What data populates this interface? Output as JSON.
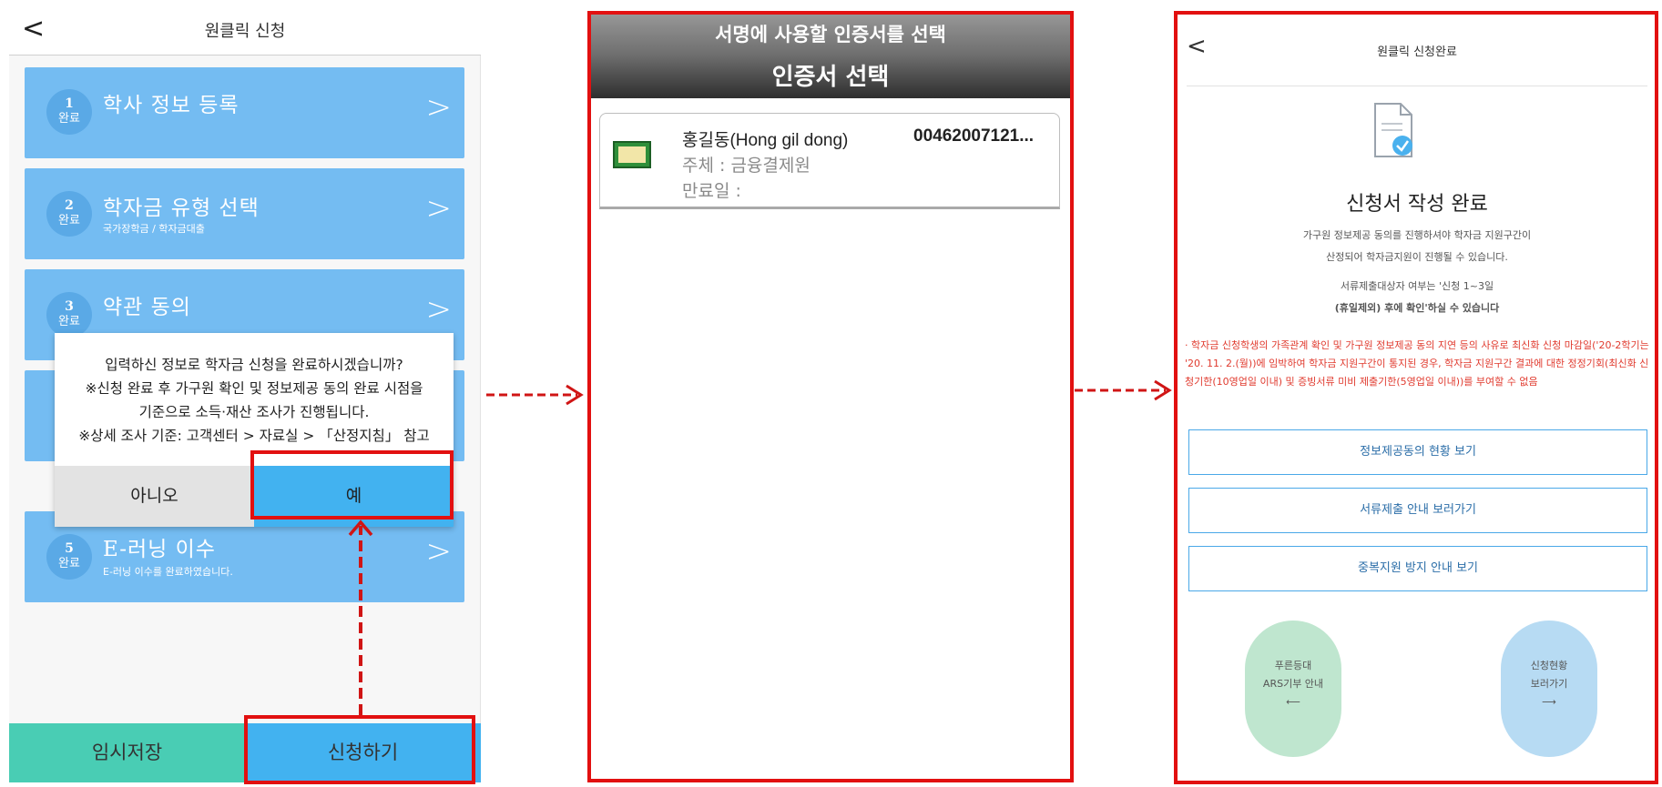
{
  "panel1": {
    "back_icon": "chevron-left-icon",
    "title": "원클릭 신청",
    "steps": [
      {
        "num": "1",
        "status": "완료",
        "label": "학사 정보 등록",
        "sub": ""
      },
      {
        "num": "2",
        "status": "완료",
        "label": "학자금 유형 선택",
        "sub": "국가장학금 / 학자금대출"
      },
      {
        "num": "3",
        "status": "완료",
        "label": "약관 동의",
        "sub": ""
      },
      {
        "num": "5",
        "status": "완료",
        "label": "E-러닝 이수",
        "sub": "E-러닝 이수를 완료하였습니다."
      }
    ],
    "dialog": {
      "lines": [
        "입력하신 정보로 학자금 신청을 완료하시겠습니까?",
        "※신청 완료 후 가구원 확인 및 정보제공 동의 완료 시점을",
        "기준으로 소득·재산 조사가 진행됩니다.",
        "※상세 조사 기준: 고객센터 > 자료실 > 「산정지침」 참고"
      ],
      "no_label": "아니오",
      "yes_label": "예"
    },
    "save_label": "임시저장",
    "apply_label": "신청하기"
  },
  "panel2": {
    "title1": "서명에 사용할 인증서를 선택",
    "title2": "인증서 선택",
    "cert": {
      "name": "홍길동(Hong gil dong)",
      "serial": "00462007121...",
      "issuer": "주체 : 금융결제원",
      "expiry": "만료일 :"
    }
  },
  "panel3": {
    "back_icon": "chevron-left-icon",
    "title": "원클릭 신청완료",
    "done_title": "신청서 작성 완료",
    "desc1": "가구원 정보제공 동의를 진행하셔야 학자금 지원구간이",
    "desc2": "산정되어 학자금지원이 진행될 수 있습니다.",
    "desc3": "서류제출대상자 여부는 '신청 1~3일",
    "desc4": "(휴일제외) 후에 확인'하실 수 있습니다",
    "warning": "· 학자금 신청학생의 가족관계 확인 및 가구원 정보제공 동의 지연 등의 사유로 최신화 신청 마감일('20-2학기는 '20. 11. 2.(월))에 임박하여 학자금 지원구간이 통지된 경우, 학자금 지원구간 결과에 대한 정정기회(최신화 신청기한(10영업일 이내) 및 증빙서류 미비 제출기한(5영업일 이내))를 부여할 수 없음",
    "buttons": [
      "정보제공동의 현황 보기",
      "서류제출 안내 보러가기",
      "중복지원 방지 안내 보기"
    ],
    "circle1": {
      "line1": "푸른등대",
      "line2": "ARS기부 안내",
      "line3": "⟵"
    },
    "circle2": {
      "line1": "신청현황",
      "line2": "보러가기",
      "line3": "⟶"
    }
  }
}
